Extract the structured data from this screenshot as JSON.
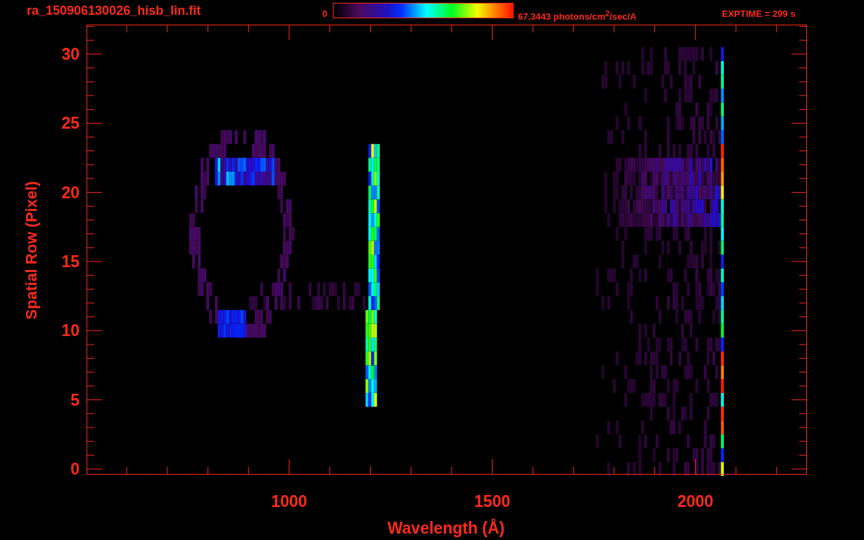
{
  "header": {
    "filename": "ra_150906130026_hisb_lin.fit",
    "colorbar": {
      "min_label": "0",
      "max_label": "67.3443 photons/cm$^{2}$/sec/A"
    },
    "exposure": "EXPTIME = 299 s"
  },
  "plot": {
    "ylabel": "Spatial Row (Pixel)",
    "xlabel": "Wavelength (Å)",
    "yticks": [
      "30",
      "25",
      "20",
      "15",
      "10",
      "5",
      "0"
    ],
    "xticks": [
      "1000",
      "1500",
      "2000"
    ]
  }
}
